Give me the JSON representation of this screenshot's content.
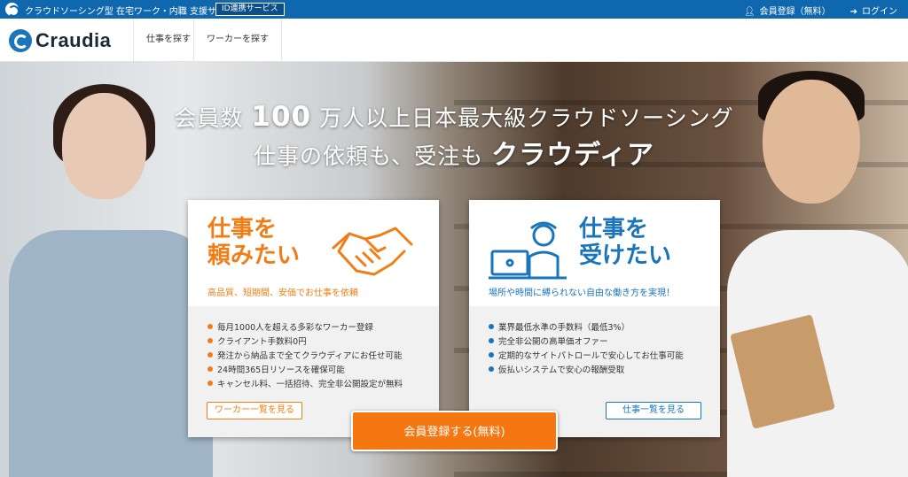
{
  "topbar": {
    "tagline": "クラウドソーシング型 在宅ワーク・内職 支援サービス",
    "id_badge": "ID連携サービス",
    "register_label": "会員登録（無料）",
    "login_label": "ログイン",
    "user_icon": "user-icon",
    "login_icon": "login-icon"
  },
  "nav": {
    "brand": "Craudia",
    "items": [
      {
        "label": "仕事を探す"
      },
      {
        "label": "ワーカーを探す"
      }
    ]
  },
  "hero": {
    "headline_pre": "会員数",
    "headline_num": "100",
    "headline_post": "万人以上日本最大級クラウドソーシング",
    "line2_pre": "仕事の依頼も、受注も",
    "line2_brand": "クラウディア"
  },
  "cards": {
    "left": {
      "title_a": "仕事を",
      "title_b": "頼みたい",
      "desc": "高品質、短期間、安価でお仕事を依頼",
      "bullets": [
        "毎月1000人を超える多彩なワーカー登録",
        "クライアント手数料0円",
        "発注から納品まで全てクラウディアにお任せ可能",
        "24時間365日リソースを確保可能",
        "キャンセル料、一括招待、完全非公開設定が無料"
      ],
      "button": "ワーカー一覧を見る",
      "icon": "handshake-icon",
      "accent": "#f07d16"
    },
    "right": {
      "title_a": "仕事を",
      "title_b": "受けたい",
      "desc": "場所や時間に縛られない自由な働き方を実現！",
      "bullets": [
        "業界最低水準の手数料（最低3%）",
        "完全非公開の高単価オファー",
        "定期的なサイトパトロールで安心してお仕事可能",
        "仮払いシステムで安心の報酬受取"
      ],
      "button": "仕事一覧を見る",
      "icon": "worker-laptop-icon",
      "accent": "#1a74ba"
    }
  },
  "cta": {
    "label": "会員登録する(無料)",
    "color": "#f47712"
  }
}
